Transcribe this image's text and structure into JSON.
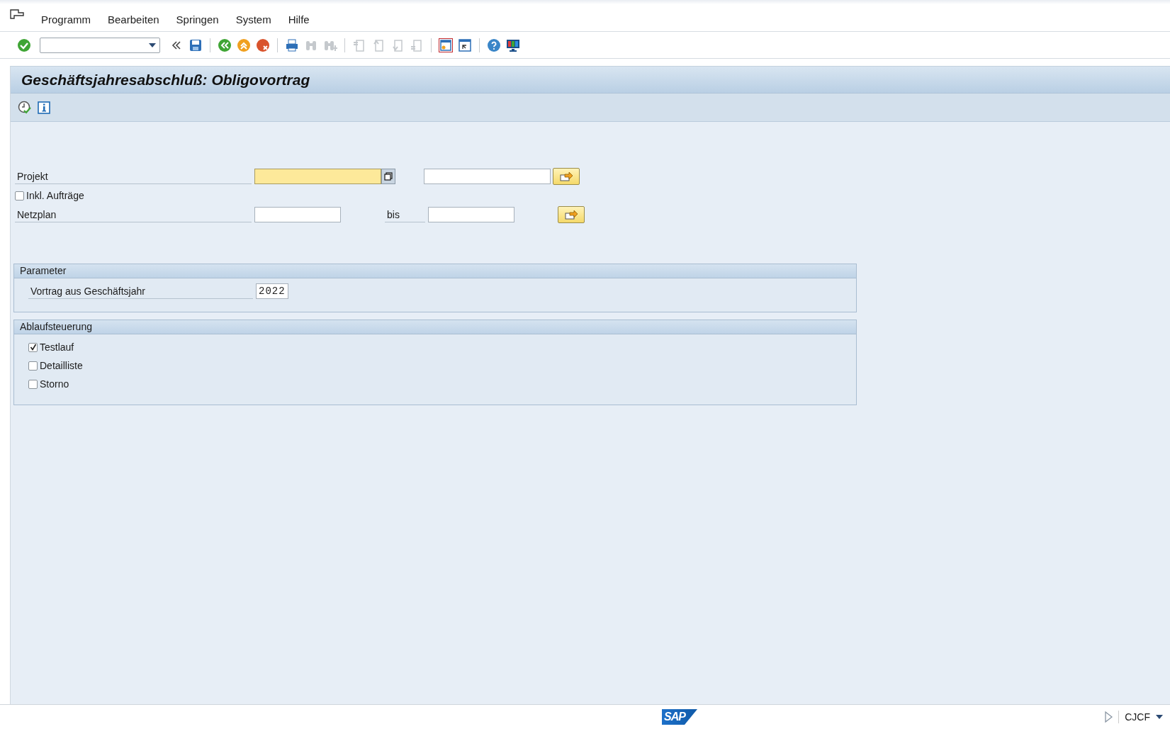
{
  "menu": [
    {
      "label": "Programm"
    },
    {
      "label": "Bearbeiten"
    },
    {
      "label": "Springen"
    },
    {
      "label": "System"
    },
    {
      "label": "Hilfe"
    }
  ],
  "title": "Geschäftsjahresabschluß: Obligovortrag",
  "selection": [
    {
      "kind": "range",
      "label": "Projekt",
      "focused": true,
      "value_help": true
    },
    {
      "kind": "checkbox",
      "label": "Inkl. Aufträge",
      "checked": false
    },
    {
      "kind": "range",
      "label": "Netzplan",
      "to_label": "bis",
      "focused": false,
      "value_help": false
    }
  ],
  "groups": [
    {
      "title": "Parameter",
      "items": [
        {
          "kind": "field",
          "label": "Vortrag aus Geschäftsjahr",
          "value": "2022"
        }
      ]
    },
    {
      "title": "Ablaufsteuerung",
      "items": [
        {
          "kind": "checkbox",
          "label": "Testlauf",
          "checked": true
        },
        {
          "kind": "checkbox",
          "label": "Detailliste",
          "checked": false
        },
        {
          "kind": "checkbox",
          "label": "Storno",
          "checked": false
        }
      ]
    }
  ],
  "status_bar": {
    "logo": "SAP",
    "transaction": "CJCF"
  }
}
